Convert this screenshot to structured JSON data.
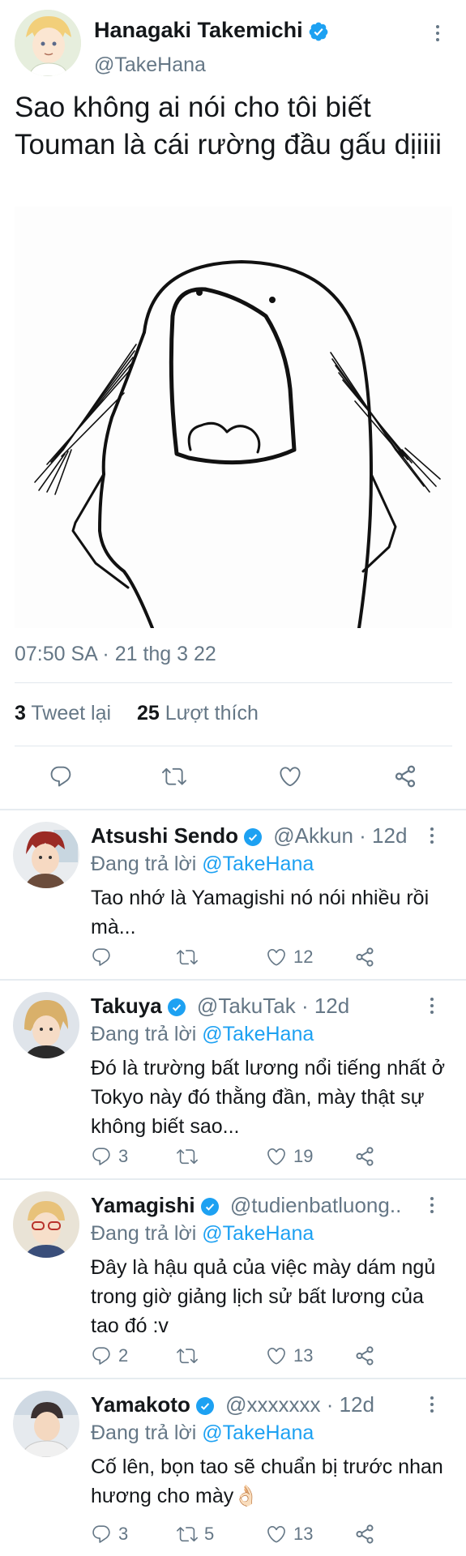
{
  "main_tweet": {
    "author_name": "Hanagaki Takemichi",
    "author_handle": "@TakeHana",
    "text": "Sao không ai nói cho tôi biết Touman là cái rường đầu gấu dịiiii",
    "timestamp": "07:50 SA · 21 thg 3 22",
    "retweets_count": "3",
    "retweets_label": "Tweet lại",
    "likes_count": "25",
    "likes_label": "Lượt thích",
    "actions": [
      "reply-icon",
      "retweet-icon",
      "like-icon",
      "share-icon"
    ]
  },
  "replies": [
    {
      "name": "Atsushi Sendo",
      "handle": "@Akkun",
      "time": "· 12d",
      "replying_prefix": "Đang trả lời",
      "replying_to": "@TakeHana",
      "text": "Tao nhớ là Yamagishi nó nói nhiều rồi mà...",
      "reply_count": "",
      "retweet_count": "",
      "like_count": "12"
    },
    {
      "name": "Takuya",
      "handle": "@TakuTak",
      "time": "· 12d",
      "replying_prefix": "Đang trả lời",
      "replying_to": "@TakeHana",
      "text": "Đó là trường bất lương nổi tiếng nhất ở Tokyo này đó thằng đần, mày thật sự không biết sao...",
      "reply_count": "3",
      "retweet_count": "",
      "like_count": "19"
    },
    {
      "name": "Yamagishi",
      "handle": "@tudienbatluong..",
      "time": "",
      "replying_prefix": "Đang trả lời",
      "replying_to": "@TakeHana",
      "text": "Đây là hậu quả của việc mày dám ngủ trong giờ giảng lịch sử bất lương của tao đó :v",
      "reply_count": "2",
      "retweet_count": "",
      "like_count": "13"
    },
    {
      "name": "Yamakoto",
      "handle": "@xxxxxxx",
      "time": "· 12d",
      "replying_prefix": "Đang trả lời",
      "replying_to": "@TakeHana",
      "text": "Cố lên, bọn tao sẽ chuẩn bị trước nhan hương cho mày👌🏻",
      "reply_count": "3",
      "retweet_count": "5",
      "like_count": "13"
    }
  ],
  "colors": {
    "verified": "#1da1f2",
    "link": "#1da1f2",
    "muted": "#657786",
    "divider": "#e1e8ed"
  }
}
